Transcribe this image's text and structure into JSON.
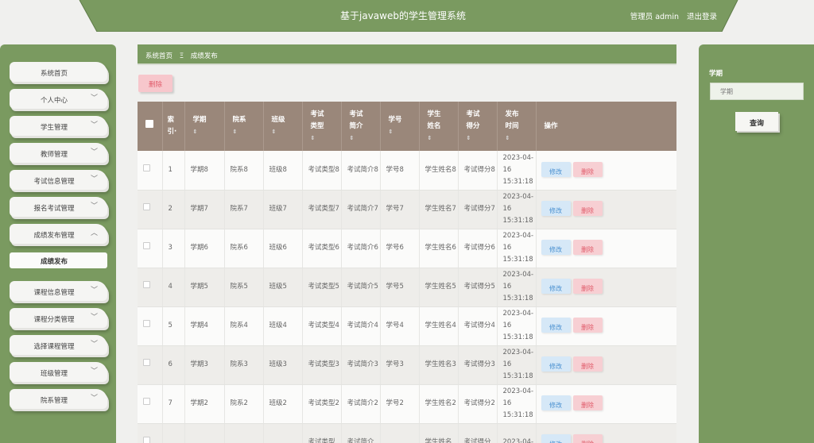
{
  "header": {
    "title": "基于javaweb的学生管理系统",
    "user": "管理员 admin",
    "logout": "退出登录"
  },
  "sidebar": {
    "items": [
      {
        "label": "系统首页",
        "chevron": false
      },
      {
        "label": "个人中心",
        "chevron": true
      },
      {
        "label": "学生管理",
        "chevron": true
      },
      {
        "label": "教师管理",
        "chevron": true
      },
      {
        "label": "考试信息管理",
        "chevron": true
      },
      {
        "label": "报名考试管理",
        "chevron": true
      },
      {
        "label": "成绩发布管理",
        "chevron": true,
        "expanded": true
      },
      {
        "label": "成绩发布",
        "sub": true
      },
      {
        "label": "课程信息管理",
        "chevron": true
      },
      {
        "label": "课程分类管理",
        "chevron": true
      },
      {
        "label": "选择课程管理",
        "chevron": true
      },
      {
        "label": "班级管理",
        "chevron": true
      },
      {
        "label": "院系管理",
        "chevron": true
      }
    ]
  },
  "breadcrumb": {
    "home": "系统首页",
    "sep": "Ξ",
    "current": "成绩发布"
  },
  "toolbar": {
    "delete_label": "删除"
  },
  "table": {
    "headers": [
      "索\n引·",
      "学期",
      "院系",
      "班级",
      "考试\n类型",
      "考试\n简介",
      "学号",
      "学生\n姓名",
      "考试\n得分",
      "发布\n时间",
      "操作"
    ],
    "edit_label": "修改",
    "delete_label": "删除",
    "rows": [
      {
        "idx": "1",
        "term": "学期8",
        "dept": "院系8",
        "cls": "班级8",
        "type": "考试类型8",
        "intro": "考试简介8",
        "sid": "学号8",
        "name": "学生姓名8",
        "score": "考试得分8",
        "time": "2023-04-16 15:31:18"
      },
      {
        "idx": "2",
        "term": "学期7",
        "dept": "院系7",
        "cls": "班级7",
        "type": "考试类型7",
        "intro": "考试简介7",
        "sid": "学号7",
        "name": "学生姓名7",
        "score": "考试得分7",
        "time": "2023-04-16 15:31:18"
      },
      {
        "idx": "3",
        "term": "学期6",
        "dept": "院系6",
        "cls": "班级6",
        "type": "考试类型6",
        "intro": "考试简介6",
        "sid": "学号6",
        "name": "学生姓名6",
        "score": "考试得分6",
        "time": "2023-04-16 15:31:18"
      },
      {
        "idx": "4",
        "term": "学期5",
        "dept": "院系5",
        "cls": "班级5",
        "type": "考试类型5",
        "intro": "考试简介5",
        "sid": "学号5",
        "name": "学生姓名5",
        "score": "考试得分5",
        "time": "2023-04-16 15:31:18"
      },
      {
        "idx": "5",
        "term": "学期4",
        "dept": "院系4",
        "cls": "班级4",
        "type": "考试类型4",
        "intro": "考试简介4",
        "sid": "学号4",
        "name": "学生姓名4",
        "score": "考试得分4",
        "time": "2023-04-16 15:31:18"
      },
      {
        "idx": "6",
        "term": "学期3",
        "dept": "院系3",
        "cls": "班级3",
        "type": "考试类型3",
        "intro": "考试简介3",
        "sid": "学号3",
        "name": "学生姓名3",
        "score": "考试得分3",
        "time": "2023-04-16 15:31:18"
      },
      {
        "idx": "7",
        "term": "学期2",
        "dept": "院系2",
        "cls": "班级2",
        "type": "考试类型2",
        "intro": "考试简介2",
        "sid": "学号2",
        "name": "学生姓名2",
        "score": "考试得分2",
        "time": "2023-04-16 15:31:18"
      },
      {
        "idx": "",
        "term": "",
        "dept": "",
        "cls": "",
        "type": "考试类型",
        "intro": "考试简介",
        "sid": "",
        "name": "学生姓名",
        "score": "考试得分",
        "time": "2023-04-"
      }
    ]
  },
  "search": {
    "label": "学期",
    "placeholder": "学期",
    "button": "查询"
  },
  "colors": {
    "primary_green": "#7a9a60",
    "table_header": "#9a877a",
    "edit_bg": "#d6e8f7",
    "delete_bg": "#f7cfd3"
  }
}
